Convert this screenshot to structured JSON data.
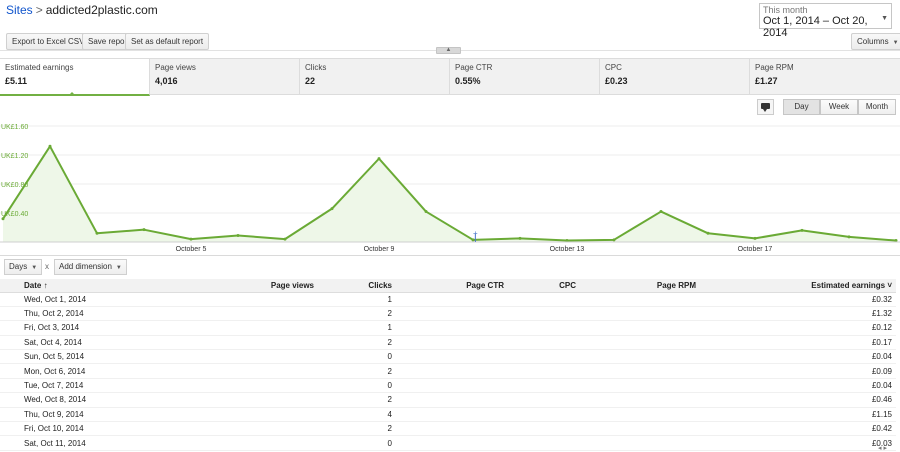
{
  "header": {
    "breadcrumb_root": "Sites",
    "breadcrumb_separator": ">",
    "site_name": "addicted2plastic.com",
    "date_range_label": "This month",
    "date_range_value": "Oct 1, 2014 – Oct 20, 2014"
  },
  "toolbar": {
    "export_label": "Export to Excel CSV",
    "save_label": "Save report",
    "default_label": "Set as default report",
    "columns_label": "Columns"
  },
  "metrics": [
    {
      "label": "Estimated earnings",
      "value": "£5.11"
    },
    {
      "label": "Page views",
      "value": "4,016"
    },
    {
      "label": "Clicks",
      "value": "22"
    },
    {
      "label": "Page CTR",
      "value": "0.55%"
    },
    {
      "label": "CPC",
      "value": "£0.23"
    },
    {
      "label": "Page RPM",
      "value": "£1.27"
    }
  ],
  "chart_controls": {
    "day": "Day",
    "week": "Week",
    "month": "Month",
    "active": "Day"
  },
  "chart_data": {
    "type": "area",
    "color": "#6aaa35",
    "fill": "#eef7e8",
    "ylim": [
      0,
      1.6
    ],
    "ytick_labels": [
      "UK£0.40",
      "UK£0.80",
      "UK£1.20",
      "UK£1.60"
    ],
    "ytick_values": [
      0.4,
      0.8,
      1.2,
      1.6
    ],
    "xtick_labels": [
      "October 5",
      "October 9",
      "October 13",
      "October 17"
    ],
    "xtick_days": [
      5,
      9,
      13,
      17
    ],
    "x": [
      1,
      2,
      3,
      4,
      5,
      6,
      7,
      8,
      9,
      10,
      11,
      12,
      13,
      14,
      15,
      16,
      17,
      18,
      19,
      20
    ],
    "values": [
      0.32,
      1.32,
      0.12,
      0.17,
      0.04,
      0.09,
      0.04,
      0.46,
      1.15,
      0.42,
      0.03,
      0.05,
      0.02,
      0.03,
      0.42,
      0.12,
      0.05,
      0.16,
      0.07,
      0.02
    ]
  },
  "table_controls": {
    "dimension_label": "Days",
    "remove_symbol": "x",
    "add_dimension_label": "Add dimension"
  },
  "table": {
    "columns": [
      "Date",
      "Page views",
      "Clicks",
      "Page CTR",
      "CPC",
      "Page RPM",
      "Estimated earnings"
    ],
    "sort_indicators": [
      "↑",
      "",
      "",
      "",
      "",
      "",
      "˅"
    ],
    "rows": [
      {
        "date": "Wed, Oct 1, 2014",
        "clicks": "1",
        "earnings": "£0.32"
      },
      {
        "date": "Thu, Oct 2, 2014",
        "clicks": "2",
        "earnings": "£1.32"
      },
      {
        "date": "Fri, Oct 3, 2014",
        "clicks": "1",
        "earnings": "£0.12"
      },
      {
        "date": "Sat, Oct 4, 2014",
        "clicks": "2",
        "earnings": "£0.17"
      },
      {
        "date": "Sun, Oct 5, 2014",
        "clicks": "0",
        "earnings": "£0.04"
      },
      {
        "date": "Mon, Oct 6, 2014",
        "clicks": "2",
        "earnings": "£0.09"
      },
      {
        "date": "Tue, Oct 7, 2014",
        "clicks": "0",
        "earnings": "£0.04"
      },
      {
        "date": "Wed, Oct 8, 2014",
        "clicks": "2",
        "earnings": "£0.46"
      },
      {
        "date": "Thu, Oct 9, 2014",
        "clicks": "4",
        "earnings": "£1.15"
      },
      {
        "date": "Fri, Oct 10, 2014",
        "clicks": "2",
        "earnings": "£0.42"
      },
      {
        "date": "Sat, Oct 11, 2014",
        "clicks": "0",
        "earnings": "£0.03"
      }
    ]
  },
  "icons": {
    "collapse": "collapse-arrow-icon",
    "annotation": "annotation-icon",
    "date_dropdown": "chevron-down-icon"
  }
}
